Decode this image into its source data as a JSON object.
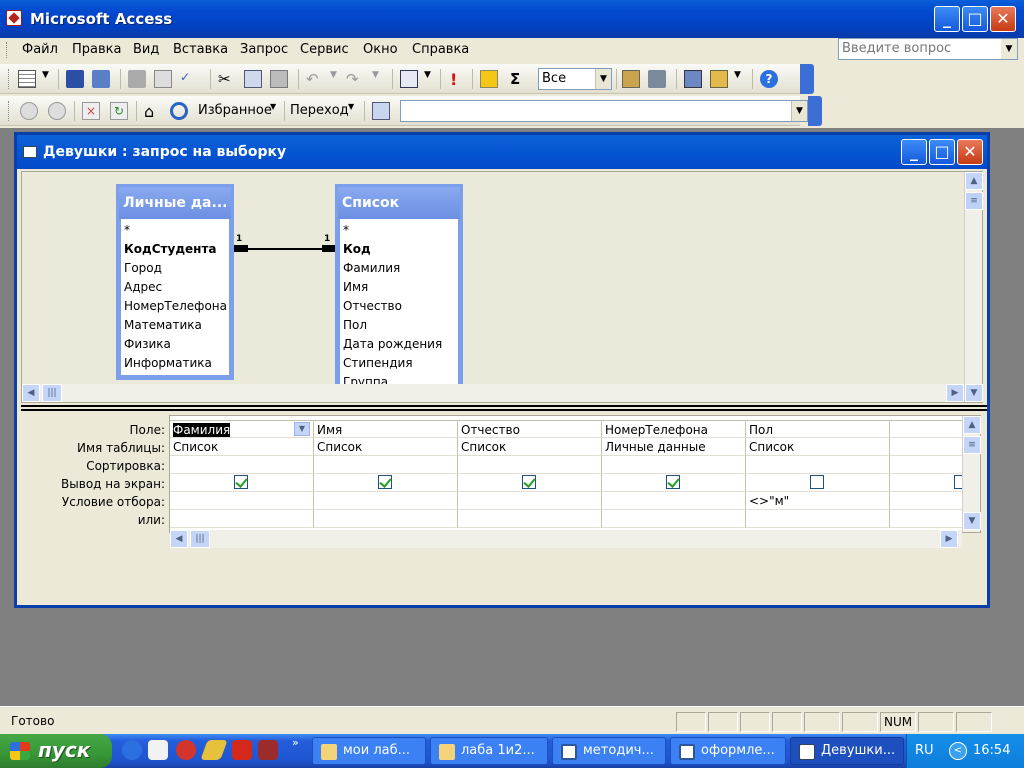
{
  "window": {
    "title": "Microsoft Access"
  },
  "menu": {
    "items": [
      "Файл",
      "Правка",
      "Вид",
      "Вставка",
      "Запрос",
      "Сервис",
      "Окно",
      "Справка"
    ]
  },
  "ask": {
    "placeholder": "Введите вопрос"
  },
  "toolbar1": {
    "query_type_value": "Все"
  },
  "toolbar2": {
    "favorites_label": "Избранное",
    "goto_label": "Переход",
    "address_value": ""
  },
  "query_window": {
    "title": "Девушки : запрос на выборку"
  },
  "tables": [
    {
      "title": "Личные да...",
      "fields": [
        "*",
        "КодСтудента",
        "Город",
        "Адрес",
        "НомерТелефона",
        "Математика",
        "Физика",
        "Информатика"
      ],
      "key_field": "КодСтудента"
    },
    {
      "title": "Список",
      "fields": [
        "*",
        "Код",
        "Фамилия",
        "Имя",
        "Отчество",
        "Пол",
        "Дата рождения",
        "Стипендия",
        "Группа"
      ],
      "key_field": "Код"
    }
  ],
  "relation": {
    "left_label": "1",
    "right_label": "1"
  },
  "grid": {
    "row_labels": [
      "Поле:",
      "Имя таблицы:",
      "Сортировка:",
      "Вывод на экран:",
      "Условие отбора:",
      "или:"
    ],
    "columns": [
      {
        "field": "Фамилия",
        "table": "Список",
        "show": true,
        "criteria": ""
      },
      {
        "field": "Имя",
        "table": "Список",
        "show": true,
        "criteria": ""
      },
      {
        "field": "Отчество",
        "table": "Список",
        "show": true,
        "criteria": ""
      },
      {
        "field": "НомерТелефона",
        "table": "Личные данные",
        "show": true,
        "criteria": ""
      },
      {
        "field": "Пол",
        "table": "Список",
        "show": false,
        "criteria": "<>\"м\""
      }
    ]
  },
  "status": {
    "text": "Готово",
    "num": "NUM"
  },
  "taskbar": {
    "start_label": "пуск",
    "tasks": [
      "мои лаб...",
      "лаба 1и2...",
      "методич...",
      "оформле...",
      "Девушки..."
    ],
    "lang": "RU",
    "clock": "16:54"
  },
  "colors": {
    "titlebar": "#0349cf",
    "table_header": "#7b9fe8",
    "taskbar": "#245edb",
    "start": "#379637"
  }
}
